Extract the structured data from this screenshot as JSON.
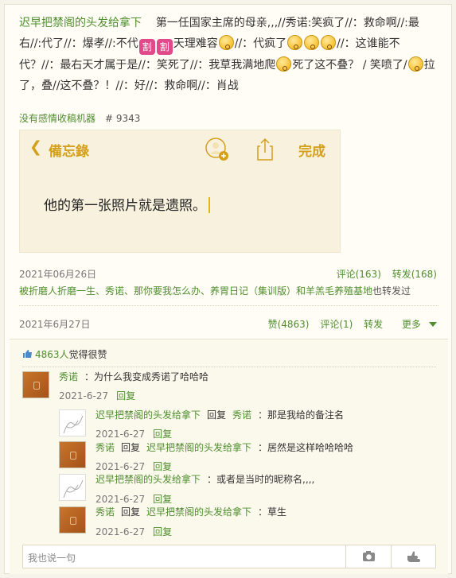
{
  "post": {
    "author": "迟早把禁阁的头发给拿下",
    "text": "第一任国家主席的母亲,,,//秀诺:笑疯了//：救命啊//:最右//:代了//：爆孝//:不代",
    "emoji_cut": "割",
    "text_b": "天理难容",
    "text_c": "//：代疯了",
    "text_d": "//：这谁能不代？//：最右天才属于是//：笑死了//：我草我满地爬",
    "text_e": "死了这不叠？ / 笑喷了/",
    "text_f": "拉了，叠//这不叠？！//：好//：救命啊//：肖战"
  },
  "source": {
    "name": "没有感情收稿机器",
    "number": "# 9343"
  },
  "note_image": {
    "back_label": "備忘錄",
    "done_label": "完成",
    "text": "他的第一张照片就是遗照。"
  },
  "repost": {
    "date": "2021年06月26日",
    "comment_label": "评论(163)",
    "forward_label": "转发(168)",
    "forwarded_by_names": "被折磨人折磨一生、秀诺、那你要我怎么办、养胃日记（集训版）和羊羔毛养殖基地",
    "forwarded_by_suffix": "也转发过"
  },
  "actions": {
    "date": "2021年6月27日",
    "like_label": "赞(4863)",
    "comment_label": "评论(1)",
    "forward_label": "转发",
    "more_label": "更多"
  },
  "likes": {
    "count": "4863人",
    "suffix": "觉得很赞"
  },
  "comments": [
    {
      "author": "秀诺",
      "text": "：为什么我变成秀诺了哈哈哈",
      "date": "2021-6-27",
      "reply": "回复"
    },
    {
      "author": "迟早把禁阁的头发给拿下",
      "reply_word": "回复",
      "target": "秀诺",
      "text": "：那是我给的备注名",
      "date": "2021-6-27",
      "reply": "回复"
    },
    {
      "author": "秀诺",
      "reply_word": "回复",
      "target": "迟早把禁阁的头发给拿下",
      "text": "：居然是这样哈哈哈哈",
      "date": "2021-6-27",
      "reply": "回复"
    },
    {
      "author": "迟早把禁阁的头发给拿下",
      "text": "：或者是当时的昵称名,,,,",
      "date": "2021-6-27",
      "reply": "回复"
    },
    {
      "author": "秀诺",
      "reply_word": "回复",
      "target": "迟早把禁阁的头发给拿下",
      "text": "：草生",
      "date": "2021-6-27",
      "reply": "回复"
    }
  ],
  "input": {
    "placeholder": "我也说一句"
  },
  "icons": {
    "like": "thumb-up-icon",
    "camera": "camera-icon",
    "hand": "hand-point-icon",
    "back": "chevron-left-icon",
    "share": "share-icon",
    "contact": "add-contact-icon"
  },
  "colors": {
    "accent_green": "#4e8e2e",
    "note_gold": "#d4a01b",
    "cut_pink": "#e04a8a"
  }
}
